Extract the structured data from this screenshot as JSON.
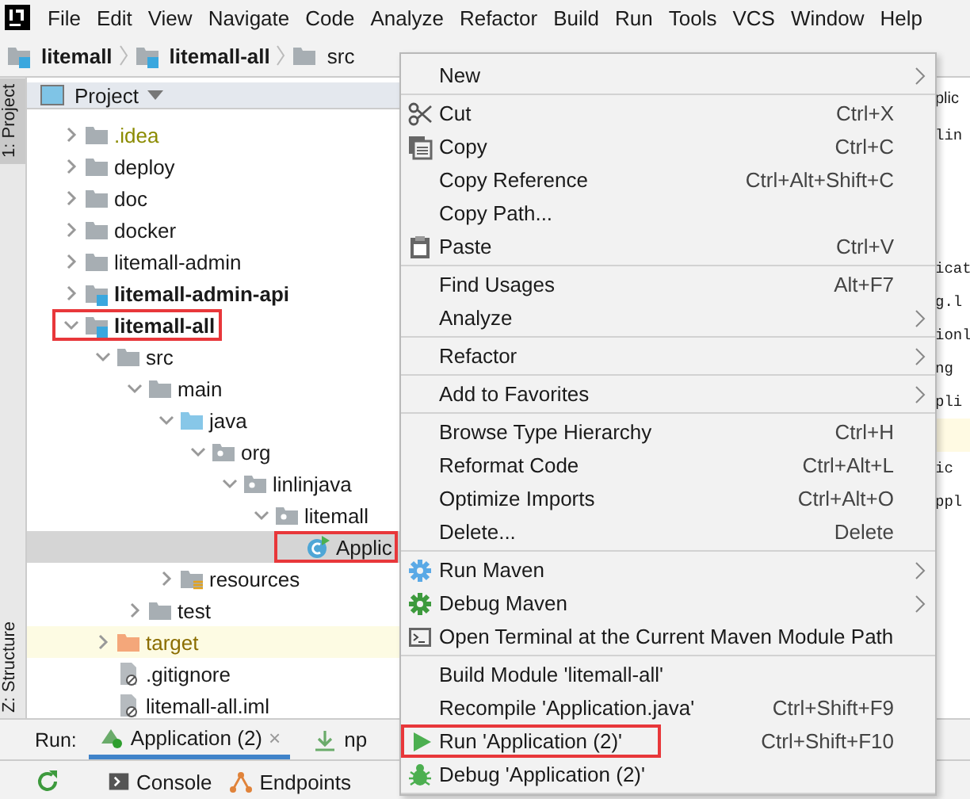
{
  "menu_bar": [
    "File",
    "Edit",
    "View",
    "Navigate",
    "Code",
    "Analyze",
    "Refactor",
    "Build",
    "Run",
    "Tools",
    "VCS",
    "Window",
    "Help"
  ],
  "breadcrumbs": [
    "litemall",
    "litemall-all",
    "src"
  ],
  "side_tabs": [
    "1: Project",
    "Z: Structure"
  ],
  "project_panel": {
    "title": "Project",
    "tree": [
      {
        "label": ".idea",
        "kind": "folder",
        "ignored": true,
        "expanded": false,
        "selected": false
      },
      {
        "label": "deploy",
        "kind": "folder",
        "expanded": false,
        "selected": false
      },
      {
        "label": "doc",
        "kind": "folder",
        "expanded": false,
        "selected": false
      },
      {
        "label": "docker",
        "kind": "folder",
        "expanded": false,
        "selected": false
      },
      {
        "label": "litemall-admin",
        "kind": "folder",
        "expanded": false,
        "selected": false
      },
      {
        "label": "litemall-admin-api",
        "kind": "module",
        "expanded": false,
        "selected": false
      },
      {
        "label": "litemall-all",
        "kind": "module",
        "expanded": true,
        "selected": false,
        "highlighted": true,
        "children": [
          {
            "label": "src",
            "kind": "folder",
            "expanded": true,
            "selected": false,
            "children": [
              {
                "label": "main",
                "kind": "folder",
                "expanded": true,
                "selected": false,
                "children": [
                  {
                    "label": "java",
                    "kind": "source",
                    "expanded": true,
                    "selected": false,
                    "children": [
                      {
                        "label": "org",
                        "kind": "package",
                        "expanded": true,
                        "selected": false,
                        "children": [
                          {
                            "label": "linlinjava",
                            "kind": "package",
                            "expanded": true,
                            "selected": false,
                            "children": [
                              {
                                "label": "litemall",
                                "kind": "package",
                                "expanded": true,
                                "selected": false,
                                "children": [
                                  {
                                    "label": "Applic",
                                    "kind": "class",
                                    "selected": true,
                                    "highlighted": true
                                  }
                                ]
                              }
                            ]
                          }
                        ]
                      }
                    ]
                  },
                  {
                    "label": "resources",
                    "kind": "resources",
                    "expanded": false,
                    "selected": false
                  }
                ]
              },
              {
                "label": "test",
                "kind": "folder",
                "expanded": false,
                "selected": false
              }
            ]
          },
          {
            "label": "target",
            "kind": "excluded",
            "excluded": true,
            "expanded": false,
            "selected": false
          },
          {
            "label": ".gitignore",
            "kind": "file",
            "selected": false
          },
          {
            "label": "litemall-all.iml",
            "kind": "file",
            "selected": false
          }
        ]
      }
    ]
  },
  "editor": {
    "tab": "plic",
    "lines": [
      {
        "text": "lin"
      },
      {
        "text": "icat"
      },
      {
        "text": "g.l"
      },
      {
        "text": "ionl"
      },
      {
        "text": "ng"
      },
      {
        "text": "pli"
      },
      {
        "current": true
      },
      {
        "text": "ic"
      },
      {
        "text": "ppl"
      }
    ]
  },
  "context_menu": {
    "groups": [
      [
        {
          "label": "New",
          "kind": "plain",
          "submenu": true
        }
      ],
      [
        {
          "label": "Cut",
          "kind": "cut",
          "shortcut": "Ctrl+X"
        },
        {
          "label": "Copy",
          "kind": "copy",
          "shortcut": "Ctrl+C"
        },
        {
          "label": "Copy Reference",
          "kind": "plain",
          "shortcut": "Ctrl+Alt+Shift+C"
        },
        {
          "label": "Copy Path...",
          "kind": "plain"
        },
        {
          "label": "Paste",
          "kind": "paste",
          "shortcut": "Ctrl+V"
        }
      ],
      [
        {
          "label": "Find Usages",
          "kind": "plain",
          "shortcut": "Alt+F7"
        },
        {
          "label": "Analyze",
          "kind": "plain",
          "submenu": true
        }
      ],
      [
        {
          "label": "Refactor",
          "kind": "plain",
          "submenu": true
        }
      ],
      [
        {
          "label": "Add to Favorites",
          "kind": "plain",
          "submenu": true
        }
      ],
      [
        {
          "label": "Browse Type Hierarchy",
          "kind": "plain",
          "shortcut": "Ctrl+H"
        },
        {
          "label": "Reformat Code",
          "kind": "plain",
          "shortcut": "Ctrl+Alt+L"
        },
        {
          "label": "Optimize Imports",
          "kind": "plain",
          "shortcut": "Ctrl+Alt+O"
        },
        {
          "label": "Delete...",
          "kind": "plain",
          "shortcut": "Delete"
        }
      ],
      [
        {
          "label": "Run Maven",
          "kind": "gear-blue",
          "submenu": true
        },
        {
          "label": "Debug Maven",
          "kind": "gear-green",
          "submenu": true
        },
        {
          "label": "Open Terminal at the Current Maven Module Path",
          "kind": "terminal"
        }
      ],
      [
        {
          "label": "Build Module 'litemall-all'",
          "kind": "plain"
        },
        {
          "label": "Recompile 'Application.java'",
          "kind": "plain",
          "shortcut": "Ctrl+Shift+F9"
        },
        {
          "label": "Run 'Application (2)'",
          "kind": "run",
          "shortcut": "Ctrl+Shift+F10",
          "highlighted": true
        },
        {
          "label": "Debug 'Application (2)'",
          "kind": "debug"
        }
      ]
    ]
  },
  "run_bar": {
    "label": "Run:",
    "tabs": [
      {
        "label": "Application (2)",
        "kind": "app",
        "close": "×"
      },
      {
        "label": "np",
        "kind": "npm"
      }
    ]
  },
  "console_bar": {
    "tabs": [
      {
        "label": "Console",
        "kind": "console"
      },
      {
        "label": "Endpoints",
        "kind": "endpoints"
      }
    ]
  }
}
